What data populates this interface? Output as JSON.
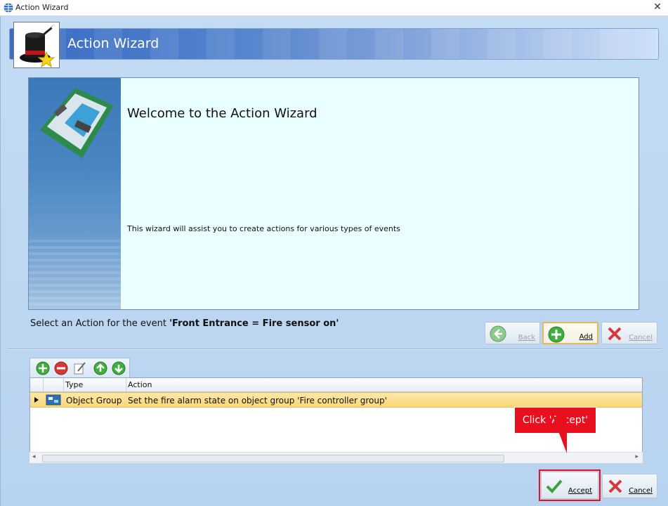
{
  "window": {
    "title": "Action Wizard",
    "close_glyph": "✕"
  },
  "banner": {
    "title": "Action Wizard",
    "icon": "magic-hat-icon"
  },
  "panel": {
    "heading": "Welcome to the Action Wizard",
    "description": "This wizard will assist you to create actions for various types of events"
  },
  "prompt": {
    "prefix": "Select an Action for the event ",
    "event": "'Front Entrance = Fire sensor on'"
  },
  "nav": {
    "back": "Back",
    "add": "Add",
    "cancel": "Cancel"
  },
  "toolbar": {
    "icons": [
      "add-icon",
      "remove-icon",
      "edit-icon",
      "move-up-icon",
      "move-down-icon"
    ]
  },
  "grid": {
    "columns": [
      "Type",
      "Action"
    ],
    "rows": [
      {
        "type": "Object Group",
        "action": "Set the fire alarm state on object group 'Fire controller group'"
      }
    ]
  },
  "callout": {
    "text": "Click 'Accept'"
  },
  "footer": {
    "accept": "Accept",
    "cancel": "Cancel"
  },
  "colors": {
    "accent_red": "#e8101f",
    "selection": "#f9d77a",
    "banner_blue": "#3a6ec4"
  }
}
